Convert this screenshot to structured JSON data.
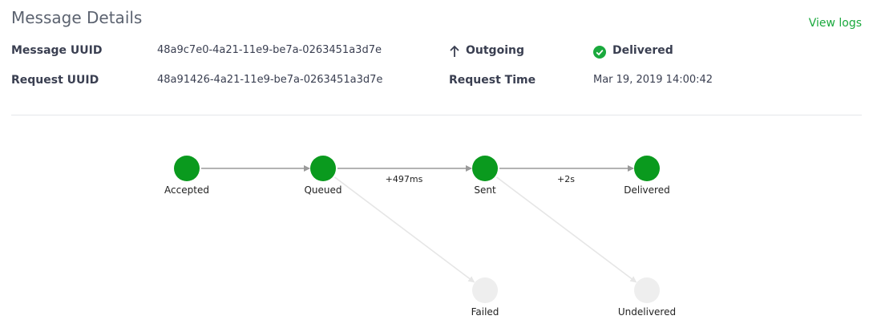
{
  "header": {
    "title": "Message Details",
    "view_logs": "View logs"
  },
  "details": {
    "message_uuid_label": "Message UUID",
    "message_uuid": "48a9c7e0-4a21-11e9-be7a-0263451a3d7e",
    "request_uuid_label": "Request UUID",
    "request_uuid": "48a91426-4a21-11e9-be7a-0263451a3d7e",
    "direction": "Outgoing",
    "direction_icon": "arrow-up-icon",
    "status": "Delivered",
    "status_icon": "check-circle-icon",
    "status_color": "#1aa93d",
    "request_time_label": "Request Time",
    "request_time": "Mar 19, 2019 14:00:42"
  },
  "flow": {
    "colors": {
      "active": "#0a9a1e",
      "inactive": "#eeeeee",
      "edge_active": "#9a9a9a",
      "edge_inactive": "#e6e6e6"
    },
    "nodes": [
      {
        "id": "accepted",
        "label": "Accepted",
        "active": true
      },
      {
        "id": "queued",
        "label": "Queued",
        "active": true
      },
      {
        "id": "sent",
        "label": "Sent",
        "active": true
      },
      {
        "id": "delivered",
        "label": "Delivered",
        "active": true
      },
      {
        "id": "failed",
        "label": "Failed",
        "active": false
      },
      {
        "id": "undelivered",
        "label": "Undelivered",
        "active": false
      }
    ],
    "edges": [
      {
        "from": "accepted",
        "to": "queued",
        "label": "",
        "active": true
      },
      {
        "from": "queued",
        "to": "sent",
        "label": "+497ms",
        "active": true
      },
      {
        "from": "sent",
        "to": "delivered",
        "label": "+2s",
        "active": true
      },
      {
        "from": "queued",
        "to": "failed",
        "label": "",
        "active": false
      },
      {
        "from": "sent",
        "to": "undelivered",
        "label": "",
        "active": false
      }
    ]
  }
}
